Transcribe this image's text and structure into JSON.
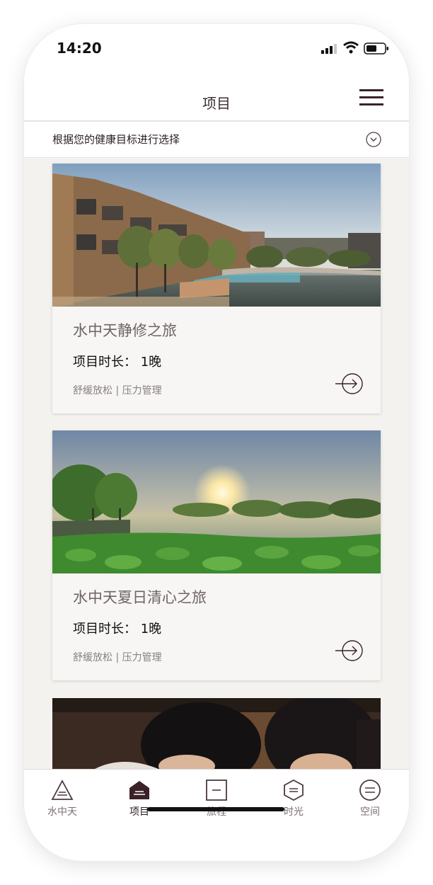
{
  "status_bar": {
    "time": "14:20"
  },
  "header": {
    "title": "项目"
  },
  "filter": {
    "label": "根据您的健康目标进行选择"
  },
  "cards": [
    {
      "title": "水中天静修之旅",
      "duration": "项目时长： 1晚",
      "tags": "舒缓放松 | 压力管理"
    },
    {
      "title": "水中天夏日清心之旅",
      "duration": "项目时长： 1晚",
      "tags": "舒缓放松 | 压力管理"
    }
  ],
  "tabs": [
    {
      "label": "水中天",
      "icon": "triangle-icon"
    },
    {
      "label": "项目",
      "icon": "house-icon",
      "active": true
    },
    {
      "label": "旅程",
      "icon": "square-icon"
    },
    {
      "label": "时光",
      "icon": "hexagon-icon"
    },
    {
      "label": "空间",
      "icon": "circle-icon"
    }
  ],
  "colors": {
    "accent": "#3a2228",
    "background": "#f4f2ef",
    "muted_text": "#8a7f84"
  }
}
